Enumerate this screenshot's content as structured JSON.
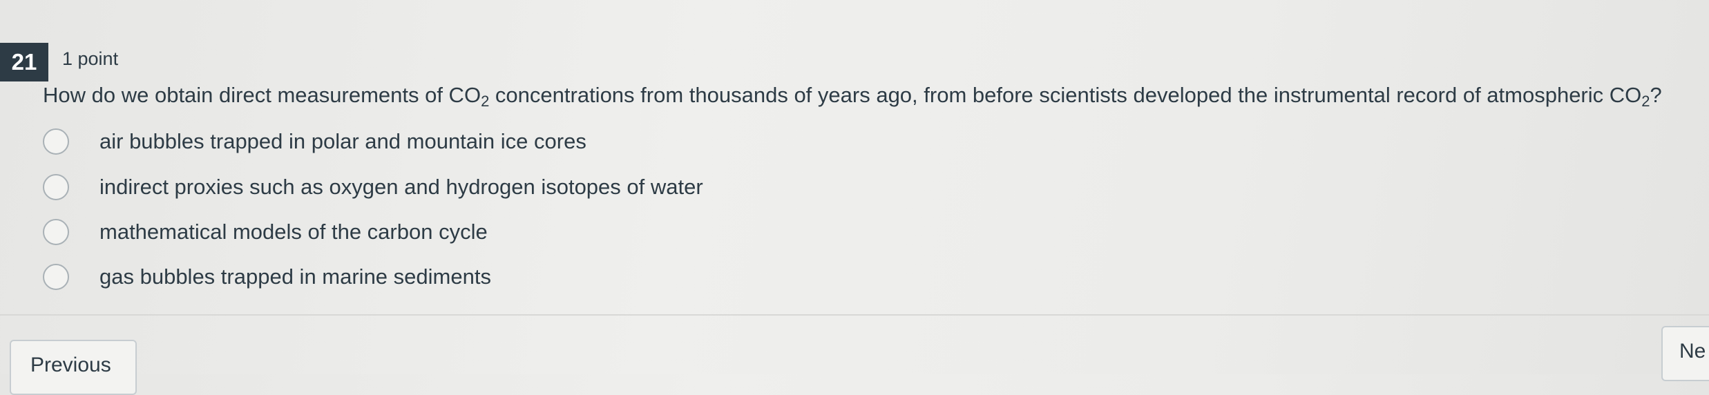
{
  "question": {
    "number": "21",
    "points": "1 point",
    "text_before": "How do we obtain direct measurements of CO",
    "sub1": "2",
    "text_middle": " concentrations from thousands of years ago, from before scientists developed the instrumental record of atmospheric CO",
    "sub2": "2",
    "text_end": "?"
  },
  "options": [
    {
      "label": "air bubbles trapped in polar and mountain ice cores"
    },
    {
      "label": "indirect proxies such as oxygen and hydrogen isotopes of water"
    },
    {
      "label": "mathematical models of the carbon cycle"
    },
    {
      "label": "gas bubbles trapped in marine sediments"
    }
  ],
  "nav": {
    "previous_label": "Previous",
    "next_label": "Ne"
  }
}
